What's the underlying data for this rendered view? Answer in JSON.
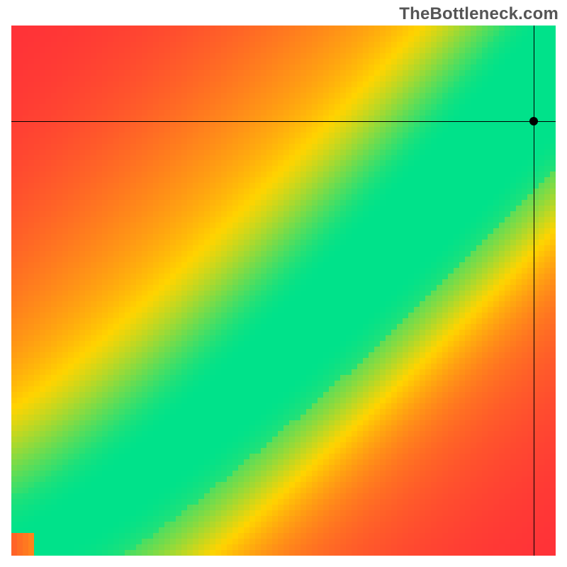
{
  "watermark": "TheBottleneck.com",
  "chart_data": {
    "type": "heatmap",
    "title": "",
    "xlabel": "",
    "ylabel": "",
    "xlim": [
      0,
      100
    ],
    "ylim": [
      0,
      100
    ],
    "grid": false,
    "crosshair": {
      "x": 96,
      "y": 82
    },
    "point": {
      "x": 96,
      "y": 82
    },
    "ridge": {
      "description": "green optimal band following a slightly super-linear diagonal from bottom-left to top-right; band widens toward top-right",
      "color_low": "#ff2b3a",
      "color_mid": "#ffd400",
      "color_high": "#00e28a",
      "exponent": 1.25,
      "band_width_frac_min": 0.03,
      "band_width_frac_max": 0.11
    },
    "resolution": {
      "cols": 96,
      "rows": 94
    }
  }
}
